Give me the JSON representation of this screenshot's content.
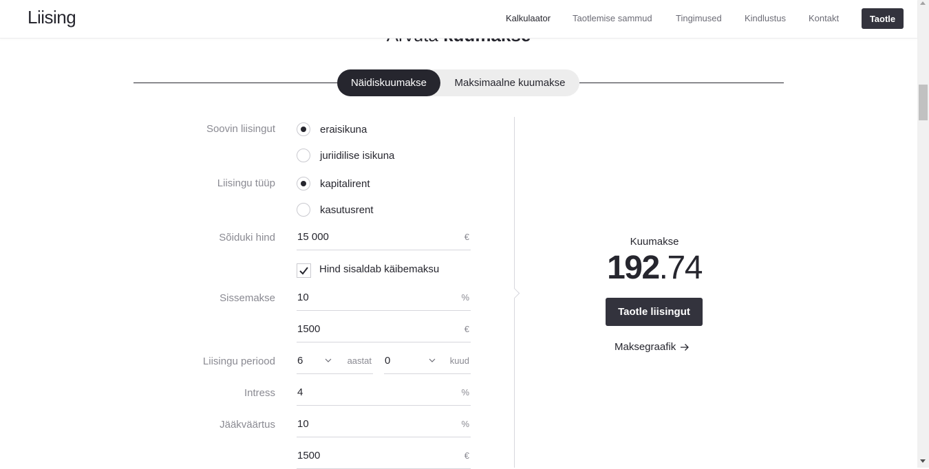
{
  "header": {
    "logo": "Liising",
    "nav": [
      "Kalkulaator",
      "Taotlemise sammud",
      "Tingimused",
      "Kindlustus",
      "Kontakt"
    ],
    "cta": "Taotle"
  },
  "section": {
    "title_light": "Arvuta",
    "title_bold": "kuumakse"
  },
  "tabs": [
    "Näidiskuumakse",
    "Maksimaalne kuumakse"
  ],
  "form": {
    "applicant": {
      "label": "Soovin liisingut",
      "options": [
        "eraisikuna",
        "juriidilise isikuna"
      ],
      "selected": "eraisikuna"
    },
    "lease_type": {
      "label": "Liisingu tüüp",
      "options": [
        "kapitalirent",
        "kasutusrent"
      ],
      "selected": "kapitalirent"
    },
    "vehicle_price": {
      "label": "Sõiduki hind",
      "value": "15 000",
      "unit": "€"
    },
    "vat_included": {
      "label": "Hind sisaldab käibemaksu",
      "checked": true
    },
    "down_payment": {
      "label": "Sissemakse",
      "percent": "10",
      "percent_unit": "%",
      "amount": "1500",
      "amount_unit": "€"
    },
    "period": {
      "label": "Liisingu periood",
      "years": "6",
      "years_unit": "aastat",
      "months": "0",
      "months_unit": "kuud"
    },
    "interest": {
      "label": "Intress",
      "value": "4",
      "unit": "%"
    },
    "residual": {
      "label": "Jääkväärtus",
      "percent": "10",
      "percent_unit": "%",
      "amount": "1500",
      "amount_unit": "€"
    }
  },
  "result": {
    "label": "Kuumakse",
    "amount_int": "192",
    "amount_dec": ".74",
    "apply_button": "Taotle liisingut",
    "schedule_link": "Maksegraafik"
  },
  "colors": {
    "dark": "#26262e",
    "button": "#33333d",
    "muted": "#8a8a92",
    "tab_bg": "#ededed"
  },
  "icons": [
    "radio-icon",
    "checkbox-check-icon",
    "chevron-down-icon",
    "arrow-right-icon"
  ]
}
